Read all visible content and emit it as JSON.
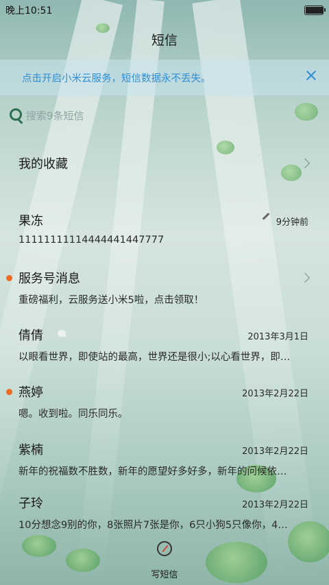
{
  "status_bar": {
    "time": "晚上10:51",
    "battery_level": 1.0
  },
  "header": {
    "title": "短信"
  },
  "cloud_banner": {
    "text": "点击开启小米云服务，短信数据永不丢失。",
    "close_icon": "close-icon"
  },
  "search": {
    "placeholder": "搜索9条短信",
    "icon": "search-icon"
  },
  "conversations": [
    {
      "name": "我的收藏",
      "snippet": "",
      "date": "",
      "unread": false,
      "chevron": true
    },
    {
      "name": "果冻",
      "snippet": "11111111114444441447777",
      "date": "9分钟前",
      "unread": false,
      "draft": true
    },
    {
      "name": "服务号消息",
      "snippet": "重磅福利，云服务送小米5啦，点击领取！",
      "date": "",
      "unread": true,
      "chevron": true
    },
    {
      "name": "倩倩",
      "snippet": "以眼看世界，即使站的最高，世界还是很小;以心看世界，即…",
      "date": "2013年3月1日",
      "unread": false
    },
    {
      "name": "燕婷",
      "snippet": "嗯。收到啦。同乐同乐。",
      "date": "2013年2月22日",
      "unread": true
    },
    {
      "name": "紫楠",
      "snippet": "新年的祝福数不胜数，新年的愿望好多好多，新年的问候依…",
      "date": "2013年2月22日",
      "unread": false
    },
    {
      "name": "子玲",
      "snippet": "10分想念9别的你，8张照片7张是你，6只小狗5只像你，4…",
      "date": "2013年2月22日",
      "unread": false
    }
  ],
  "compose": {
    "label": "写短信",
    "icon": "compose-icon"
  },
  "colors": {
    "accent": "#2e8fd4",
    "unread": "#ef6a22",
    "banner_bg": "#c8e4f0"
  }
}
